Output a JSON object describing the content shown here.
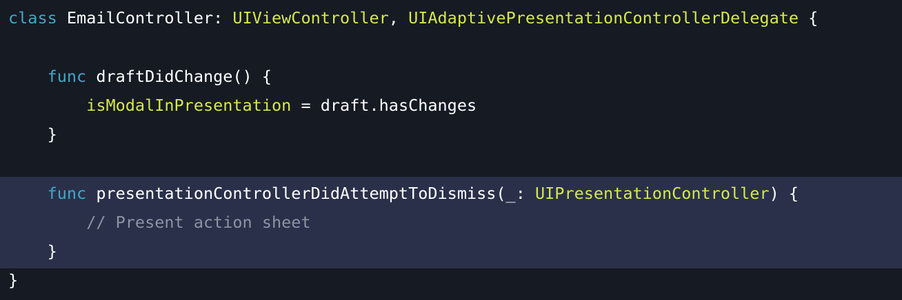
{
  "code": {
    "line1": {
      "kw": "class",
      "name": " EmailController: ",
      "type1": "UIViewController",
      "sep": ", ",
      "type2": "UIAdaptivePresentationControllerDelegate",
      "brace": " {"
    },
    "line2": {
      "indent": "    ",
      "kw": "func",
      "rest": " draftDidChange() {"
    },
    "line3": {
      "indent": "        ",
      "prop": "isModalInPresentation",
      "rest": " = draft.hasChanges"
    },
    "line4": {
      "indent": "    ",
      "text": "}"
    },
    "line5": {
      "indent": "    ",
      "kw": "func",
      "rest": " presentationControllerDidAttemptToDismiss(_: ",
      "type": "UIPresentationController",
      "end": ") {"
    },
    "line6": {
      "indent": "        ",
      "comment": "// Present action sheet"
    },
    "line7": {
      "indent": "    ",
      "text": "}"
    },
    "line8": {
      "text": "}"
    }
  },
  "colors": {
    "background": "#161a23",
    "highlight": "#2a3049",
    "keyword": "#40a7c9",
    "type": "#d5e84a",
    "comment": "#8c93a3",
    "plain": "#ffffff"
  }
}
